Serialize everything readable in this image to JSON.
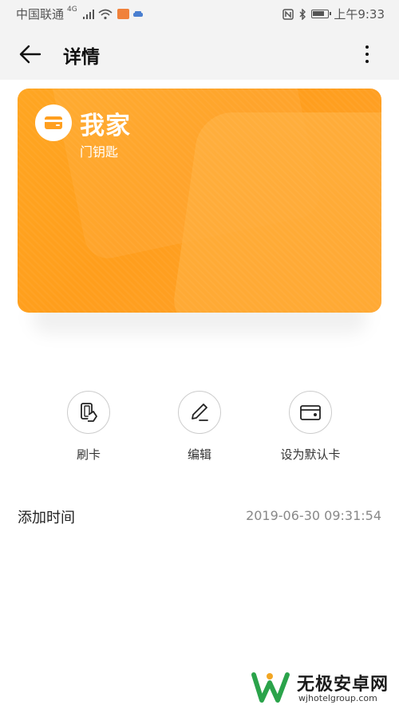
{
  "status_bar": {
    "carrier": "中国联通",
    "signal_tag": "4G",
    "time": "上午9:33"
  },
  "header": {
    "title": "详情"
  },
  "card": {
    "name": "我家",
    "type": "门钥匙",
    "color": "#ff9f1f"
  },
  "actions": [
    {
      "label": "刷卡",
      "icon": "swipe-card-icon"
    },
    {
      "label": "编辑",
      "icon": "edit-pen-icon"
    },
    {
      "label": "设为默认卡",
      "icon": "default-card-icon"
    }
  ],
  "info": {
    "added_label": "添加时间",
    "added_value": "2019-06-30 09:31:54"
  },
  "watermark": {
    "title": "无极安卓网",
    "url": "wjhotelgroup.com"
  }
}
